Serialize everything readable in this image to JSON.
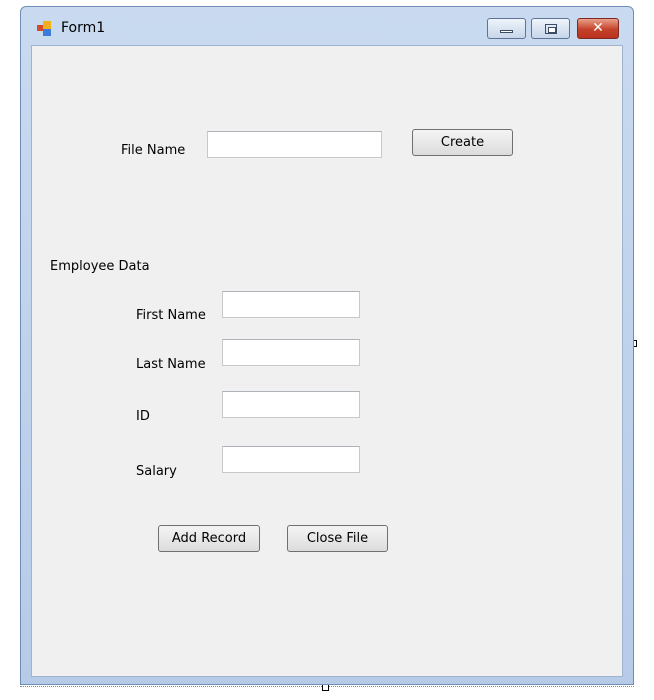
{
  "window": {
    "title": "Form1",
    "close_glyph": "✕"
  },
  "file": {
    "label": "File Name",
    "value": "",
    "create_label": "Create"
  },
  "employee": {
    "heading": "Employee Data",
    "first_name_label": "First Name",
    "first_name_value": "",
    "last_name_label": "Last Name",
    "last_name_value": "",
    "id_label": "ID",
    "id_value": "",
    "salary_label": "Salary",
    "salary_value": ""
  },
  "actions": {
    "add_record_label": "Add Record",
    "close_file_label": "Close File"
  }
}
